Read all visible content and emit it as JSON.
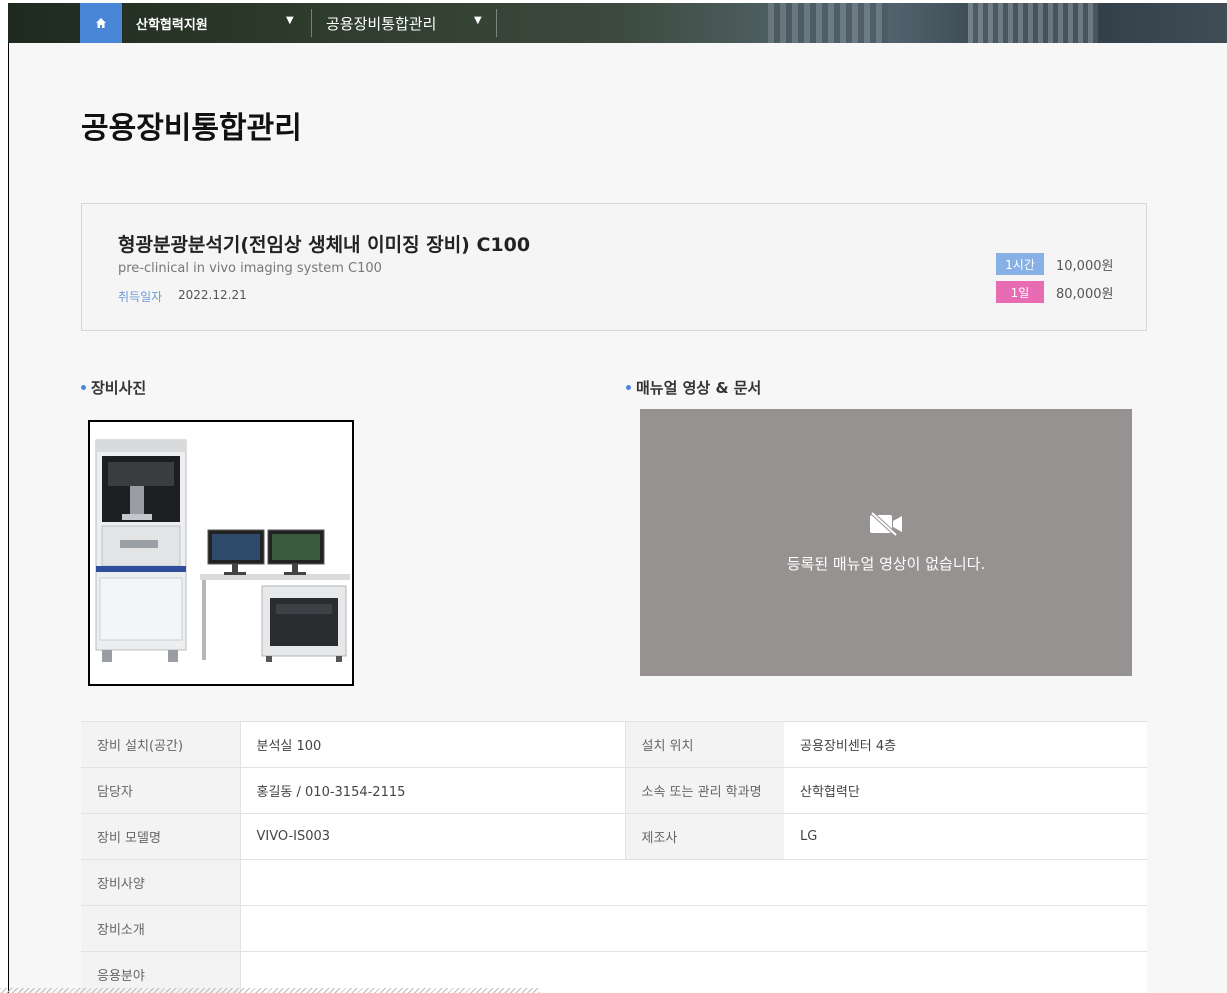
{
  "nav": {
    "level1": "산학협력지원",
    "level2": "공용장비통합관리"
  },
  "page": {
    "title": "공용장비통합관리"
  },
  "equipment": {
    "name": "형광분광분석기(전임상 생체내 이미징 장비) C100",
    "name_en": "pre-clinical in vivo imaging system C100",
    "acquired_label": "취득일자",
    "acquired_date": "2022.12.21",
    "prices": [
      {
        "unit": "1시간",
        "amount": "10,000원",
        "color": "#86b0e6"
      },
      {
        "unit": "1일",
        "amount": "80,000원",
        "color": "#e86bb4"
      }
    ]
  },
  "sections": {
    "photo_title": "장비사진",
    "manual_title": "매뉴얼 영상 & 문서",
    "no_video_message": "등록된 매뉴얼 영상이 없습니다."
  },
  "info": {
    "rows": [
      {
        "label1": "장비 설치(공간)",
        "value1": "분석실 100",
        "label2": "설치 위치",
        "value2": "공용장비센터 4층"
      },
      {
        "label1": "담당자",
        "value1": "홍길동 / 010-3154-2115",
        "label2": "소속 또는 관리 학과명",
        "value2": "산학협력단"
      },
      {
        "label1": "장비 모델명",
        "value1": "VIVO-IS003",
        "label2": "제조사",
        "value2": "LG"
      }
    ],
    "full_rows": [
      {
        "label": "장비사양",
        "value": ""
      },
      {
        "label": "장비소개",
        "value": ""
      },
      {
        "label": "응용분야",
        "value": ""
      }
    ]
  },
  "colors": {
    "accent": "#4a86d8",
    "hour_badge": "#86b0e6",
    "day_badge": "#e86bb4",
    "video_bg": "#979292"
  },
  "icons": {
    "home": "home-icon",
    "caret": "caret-down-icon",
    "video_off": "video-off-icon"
  }
}
